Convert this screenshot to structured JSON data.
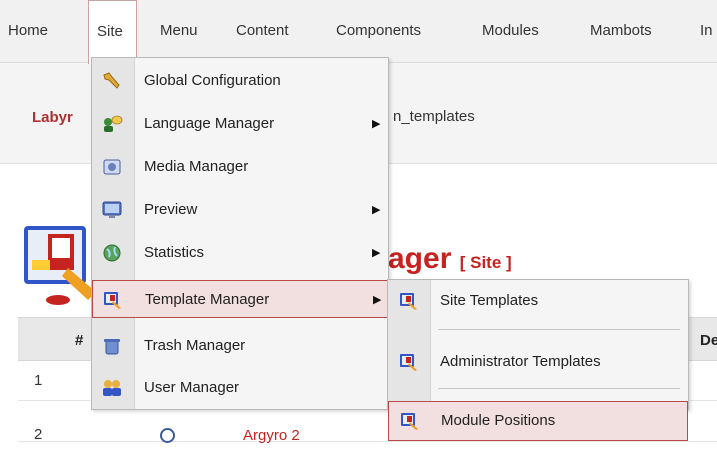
{
  "menubar": {
    "items": [
      "Home",
      "Site",
      "Menu",
      "Content",
      "Components",
      "Modules",
      "Mambots",
      "In"
    ],
    "active": "Site"
  },
  "breadcrumb": {
    "prefix": "Labyr",
    "suffix": "n_templates"
  },
  "header": {
    "title_fragment": "ager",
    "subtitle": "[ Site ]"
  },
  "table": {
    "header_number": "#",
    "header_right": "De",
    "rows": [
      {
        "num": "1",
        "name": ""
      },
      {
        "num": "2",
        "name": "Argyro 2"
      }
    ]
  },
  "site_menu": {
    "items": [
      {
        "label": "Global Configuration",
        "icon": "wrench-icon",
        "has_submenu": false
      },
      {
        "label": "Language Manager",
        "icon": "language-users-icon",
        "has_submenu": true
      },
      {
        "label": "Media Manager",
        "icon": "media-icon",
        "has_submenu": false
      },
      {
        "label": "Preview",
        "icon": "monitor-icon",
        "has_submenu": true
      },
      {
        "label": "Statistics",
        "icon": "globe-icon",
        "has_submenu": true
      },
      {
        "label": "Template Manager",
        "icon": "template-icon",
        "has_submenu": true,
        "highlighted": true
      },
      {
        "label": "Trash Manager",
        "icon": "trash-icon",
        "has_submenu": false
      },
      {
        "label": "User Manager",
        "icon": "users-icon",
        "has_submenu": false
      }
    ]
  },
  "template_submenu": {
    "items": [
      {
        "label": "Site Templates",
        "icon": "template-icon"
      },
      {
        "label": "Administrator Templates",
        "icon": "template-icon"
      },
      {
        "label": "Module Positions",
        "icon": "template-icon",
        "highlighted": true
      }
    ]
  },
  "colors": {
    "accent_red": "#c4231f",
    "highlight_bg": "#f2dfdf",
    "highlight_border": "#b84a4a"
  }
}
